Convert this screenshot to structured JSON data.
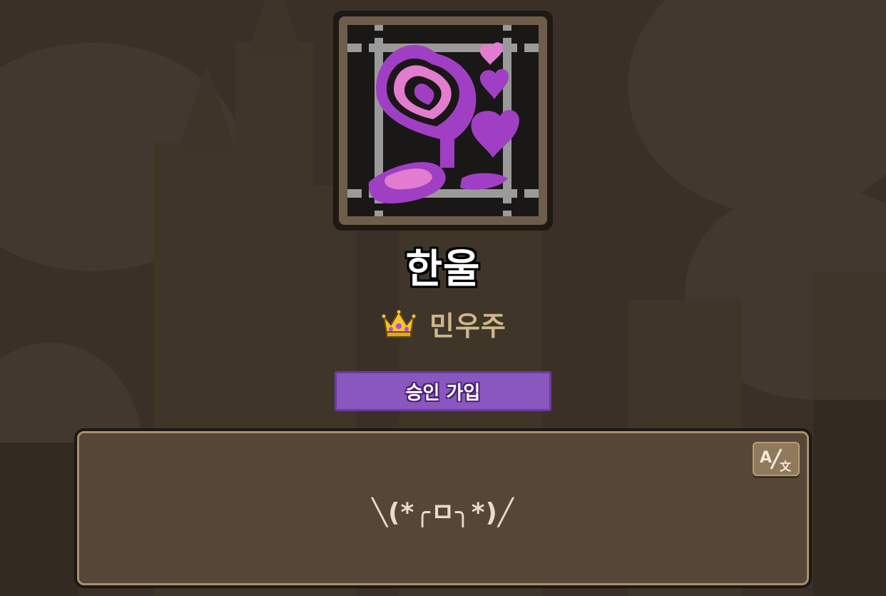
{
  "guild": {
    "name": "한울",
    "leader_name": "민우주",
    "join_type": "승인 가입",
    "introduction": "╲(*╭ㅁ╮*)╱"
  },
  "icons": {
    "emblem": "guild-emblem-hearts",
    "leader_badge": "crown-icon",
    "translate": "translate-icon"
  },
  "colors": {
    "background": "#3a3028",
    "join_button": "#8a56c0",
    "leader_name": "#cdb88c",
    "panel": "#564638",
    "panel_border": "#a7906c"
  }
}
